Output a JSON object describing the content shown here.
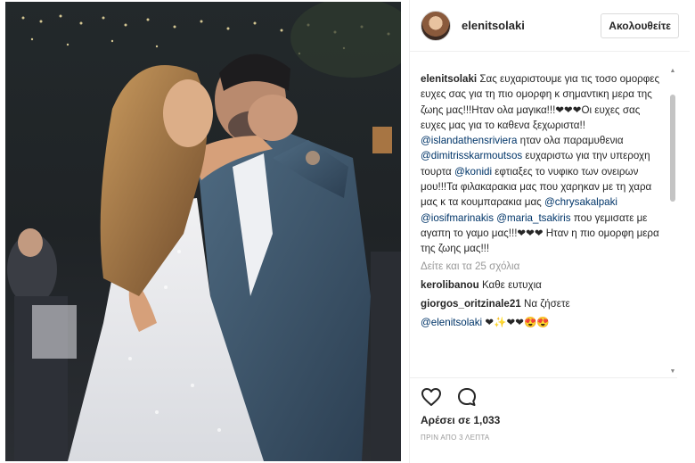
{
  "post": {
    "image_alt": "wedding-photo"
  },
  "header": {
    "username": "elenitsolaki",
    "follow_label": "Ακολουθείτε"
  },
  "caption": {
    "username": "elenitsolaki",
    "part1": " Σας ευχαριστουμε για τις τοσο ομορφες ευχες σας για τη πιο ομορφη κ σημαντικη μερα της ζωης μας!!!Ηταν ολα μαγικα!!!❤❤❤Οι ευχες σας ευχες μας για το καθενα ξεχωριστα!! ",
    "mention1": "@islandathensriviera",
    "part2": " ηταν ολα παραμυθενια ",
    "mention2": "@dimitrisskarmoutsos",
    "part3": " ευχαριστω για την υπεροχη τουρτα ",
    "mention3": "@konidi",
    "part4": " εφτιαξες το νυφικο των ονειρων μου!!!Τα φιλακαρακια μας που χαρηκαν με τη χαρα μας κ τα κουμπαρακια μας ",
    "mention4": "@chrysakalpaki",
    "part5": " ",
    "mention5": "@iosifmarinakis",
    "part6": " ",
    "mention6": "@maria_tsakiris",
    "part7": " που γεμισατε με αγαπη το γαμο μας!!!❤❤❤ Ηταν η πιο ομορφη μερα της ζωης μας!!!"
  },
  "view_all_comments": "Δείτε και τα 25 σχόλια",
  "comments": [
    {
      "username": "kerolibanou",
      "text": " Καθε ευτυχια"
    },
    {
      "username": "giorgos_oritzinale21",
      "text": " Να ζήσετε"
    },
    {
      "mention": "@elenitsolaki",
      "text": " ❤✨❤❤😍😍"
    }
  ],
  "actions": {
    "like_icon": "heart-outline-icon",
    "comment_icon": "speech-bubble-icon",
    "likes_label": "Αρέσει σε 1,033",
    "timestamp": "ΠΡΙΝ ΑΠΟ 3 ΛΕΠΤΑ"
  }
}
